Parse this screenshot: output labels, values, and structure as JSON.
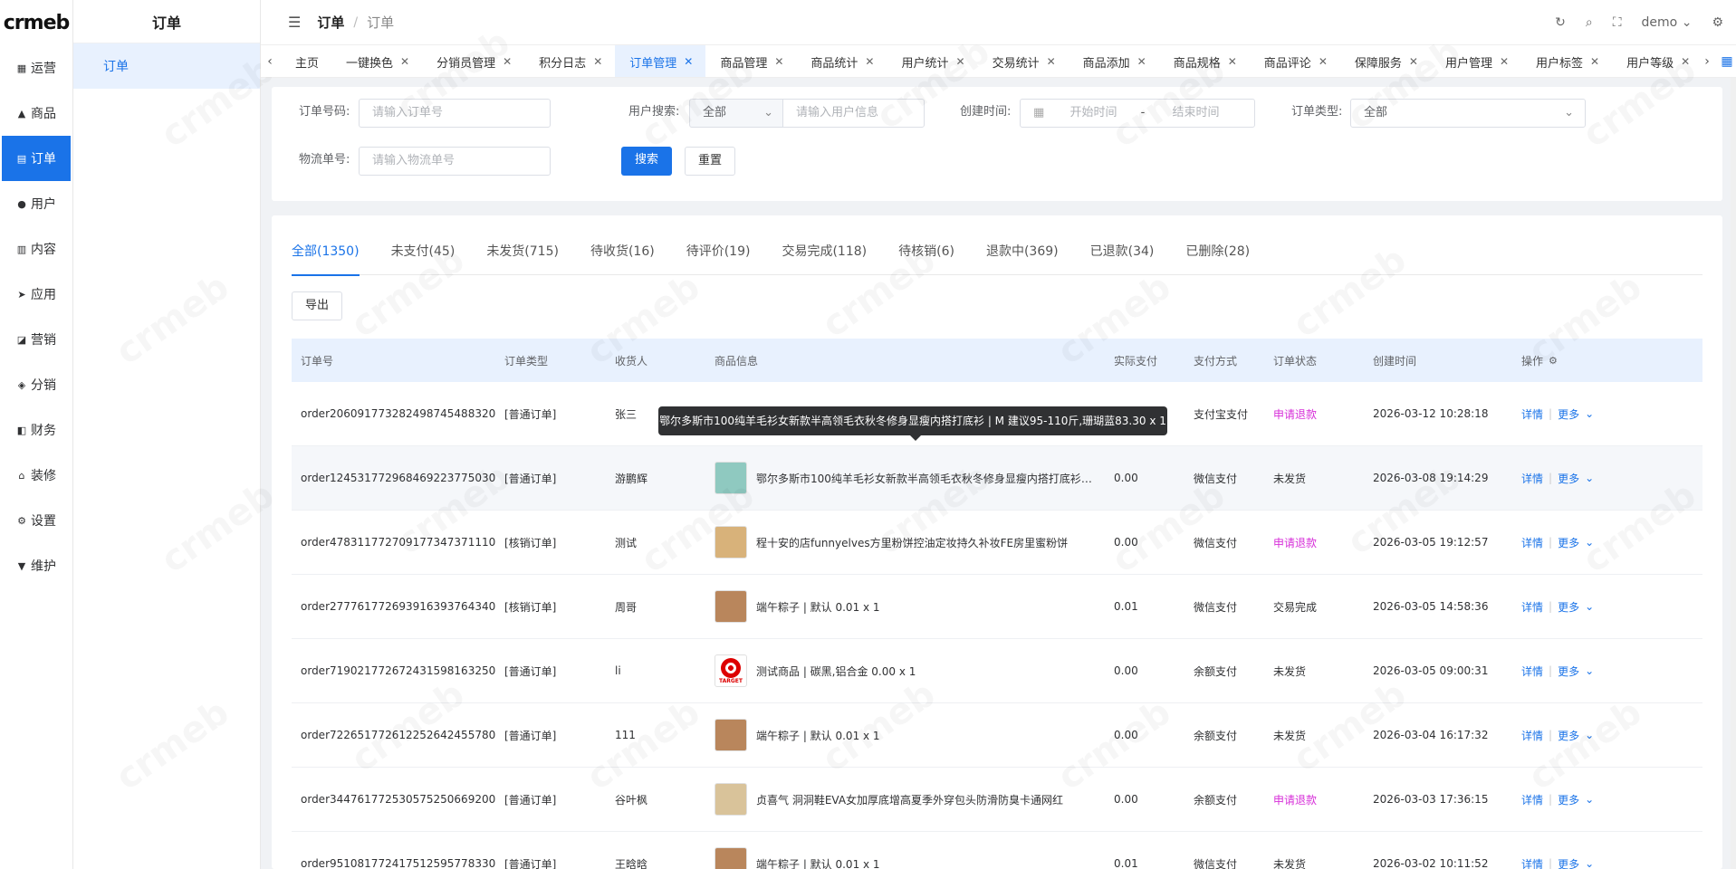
{
  "logo": "crmeb",
  "side_nav": [
    {
      "icon": "dashboard-icon",
      "glyph": "▦",
      "label": "运营"
    },
    {
      "icon": "bag-icon",
      "glyph": "▲",
      "label": "商品"
    },
    {
      "icon": "order-icon",
      "glyph": "▤",
      "label": "订单",
      "active": true
    },
    {
      "icon": "user-icon",
      "glyph": "●",
      "label": "用户"
    },
    {
      "icon": "content-icon",
      "glyph": "▥",
      "label": "内容"
    },
    {
      "icon": "app-icon",
      "glyph": "➤",
      "label": "应用"
    },
    {
      "icon": "marketing-icon",
      "glyph": "◪",
      "label": "营销"
    },
    {
      "icon": "distribution-icon",
      "glyph": "◈",
      "label": "分销"
    },
    {
      "icon": "finance-icon",
      "glyph": "◧",
      "label": "财务"
    },
    {
      "icon": "decor-icon",
      "glyph": "⌂",
      "label": "装修"
    },
    {
      "icon": "settings-icon",
      "glyph": "⚙",
      "label": "设置"
    },
    {
      "icon": "maintain-icon",
      "glyph": "▼",
      "label": "维护"
    }
  ],
  "sub_menu": {
    "title": "订单",
    "item": "订单"
  },
  "header": {
    "crumb1": "订单",
    "crumb2": "订单",
    "user": "demo"
  },
  "tabs": [
    {
      "label": "主页",
      "closable": false
    },
    {
      "label": "一键换色",
      "closable": true
    },
    {
      "label": "分销员管理",
      "closable": true
    },
    {
      "label": "积分日志",
      "closable": true
    },
    {
      "label": "订单管理",
      "closable": true,
      "active": true
    },
    {
      "label": "商品管理",
      "closable": true
    },
    {
      "label": "商品统计",
      "closable": true
    },
    {
      "label": "用户统计",
      "closable": true
    },
    {
      "label": "交易统计",
      "closable": true
    },
    {
      "label": "商品添加",
      "closable": true
    },
    {
      "label": "商品规格",
      "closable": true
    },
    {
      "label": "商品评论",
      "closable": true
    },
    {
      "label": "保障服务",
      "closable": true
    },
    {
      "label": "用户管理",
      "closable": true
    },
    {
      "label": "用户标签",
      "closable": true
    },
    {
      "label": "用户等级",
      "closable": true
    }
  ],
  "filter": {
    "order_no_label": "订单号码:",
    "order_no_placeholder": "请输入订单号",
    "user_search_label": "用户搜索:",
    "user_search_select": "全部",
    "user_search_placeholder": "请输入用户信息",
    "create_time_label": "创建时间:",
    "start_placeholder": "开始时间",
    "range_sep": "-",
    "end_placeholder": "结束时间",
    "order_type_label": "订单类型:",
    "order_type_value": "全部",
    "logistics_label": "物流单号:",
    "logistics_placeholder": "请输入物流单号",
    "search_btn": "搜索",
    "reset_btn": "重置"
  },
  "status_tabs": [
    {
      "label": "全部(1350)",
      "active": true
    },
    {
      "label": "未支付(45)"
    },
    {
      "label": "未发货(715)"
    },
    {
      "label": "待收货(16)"
    },
    {
      "label": "待评价(19)"
    },
    {
      "label": "交易完成(118)"
    },
    {
      "label": "待核销(6)"
    },
    {
      "label": "退款中(369)"
    },
    {
      "label": "已退款(34)"
    },
    {
      "label": "已删除(28)"
    }
  ],
  "export_btn": "导出",
  "columns": [
    "订单号",
    "订单类型",
    "收货人",
    "商品信息",
    "实际支付",
    "支付方式",
    "订单状态",
    "创建时间",
    "操作"
  ],
  "rows": [
    {
      "order_no": "order206091773282498745488320",
      "type": "[普通订单]",
      "receiver": "张三",
      "product": "",
      "thumb": "",
      "paid": "",
      "pay_method": "支付宝支付",
      "status": "申请退款",
      "refund": true,
      "created": "2026-03-12 10:28:18"
    },
    {
      "order_no": "order124531772968469223775030",
      "type": "[普通订单]",
      "receiver": "游鹏辉",
      "product": "鄂尔多斯市100纯羊毛衫女新款半高领毛衣秋冬修身显瘦内搭打底衫 | M 建议95-110斤,珊瑚蓝83.30 x 1",
      "thumb": "#8fc9c0",
      "paid": "0.00",
      "pay_method": "微信支付",
      "status": "未发货",
      "refund": false,
      "created": "2026-03-08 19:14:29",
      "hover": true
    },
    {
      "order_no": "order478311772709177347371110",
      "type": "[核销订单]",
      "receiver": "测试",
      "product": "程十安的店funnyelves方里粉饼控油定妆持久补妆FE房里蜜粉饼",
      "thumb": "#d8b27a",
      "paid": "0.00",
      "pay_method": "微信支付",
      "status": "申请退款",
      "refund": true,
      "created": "2026-03-05 19:12:57"
    },
    {
      "order_no": "order277761772693916393764340",
      "type": "[核销订单]",
      "receiver": "周哥",
      "product": "端午粽子 | 默认  0.01 x 1",
      "thumb": "#b9865c",
      "paid": "0.01",
      "pay_method": "微信支付",
      "status": "交易完成",
      "refund": false,
      "created": "2026-03-05 14:58:36"
    },
    {
      "order_no": "order719021772672431598163250",
      "type": "[普通订单]",
      "receiver": "li",
      "product": "测试商品 | 碳黑,铝合金  0.00 x 1",
      "thumb": "target",
      "paid": "0.00",
      "pay_method": "余额支付",
      "status": "未发货",
      "refund": false,
      "created": "2026-03-05 09:00:31"
    },
    {
      "order_no": "order722651772612252642455780",
      "type": "[普通订单]",
      "receiver": "111",
      "product": "端午粽子 | 默认  0.01 x 1",
      "thumb": "#b9865c",
      "paid": "0.00",
      "pay_method": "余额支付",
      "status": "未发货",
      "refund": false,
      "created": "2026-03-04 16:17:32"
    },
    {
      "order_no": "order344761772530575250669200",
      "type": "[普通订单]",
      "receiver": "谷叶枫",
      "product": "贞喜气 洞洞鞋EVA女加厚底增高夏季外穿包头防滑防臭卡通网红",
      "thumb": "#d9c39a",
      "paid": "0.00",
      "pay_method": "余额支付",
      "status": "申请退款",
      "refund": true,
      "created": "2026-03-03 17:36:15"
    },
    {
      "order_no": "order951081772417512595778330",
      "type": "[普通订单]",
      "receiver": "王晗晗",
      "product": "端午粽子 | 默认  0.01 x 1",
      "thumb": "#b9865c",
      "paid": "0.01",
      "pay_method": "微信支付",
      "status": "未发货",
      "refund": false,
      "created": "2026-03-02 10:11:52"
    }
  ],
  "actions": {
    "detail": "详情",
    "more": "更多"
  },
  "tooltip": "鄂尔多斯市100纯羊毛衫女新款半高领毛衣秋冬修身显瘦内搭打底衫 | M 建议95-110斤,珊瑚蓝83.30 x 1",
  "watermark": "crmeb",
  "target_text": "TARGET"
}
